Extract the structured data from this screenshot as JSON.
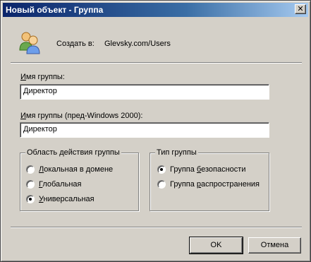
{
  "window": {
    "title": "Новый объект - Группа",
    "close_glyph": "✕"
  },
  "header": {
    "create_in_label": "Создать в:",
    "create_in_path": "Glevsky.com/Users",
    "icon": "users-group-icon"
  },
  "group_name": {
    "label_first": "И",
    "label_rest": "мя группы:",
    "value": "Директор"
  },
  "group_name_pre2000": {
    "label_first": "И",
    "label_rest": "мя группы (пред-Windows 2000):",
    "value": "Директор"
  },
  "scope": {
    "legend": "Область действия группы",
    "options": [
      {
        "pre": "",
        "u": "Л",
        "post": "окальная в домене",
        "checked": false
      },
      {
        "pre": "",
        "u": "Г",
        "post": "лобальная",
        "checked": false
      },
      {
        "pre": "",
        "u": "У",
        "post": "ниверсальная",
        "checked": true
      }
    ]
  },
  "type": {
    "legend": "Тип группы",
    "options": [
      {
        "pre": "Группа ",
        "u": "б",
        "post": "езопасности",
        "checked": true
      },
      {
        "pre": "Группа ",
        "u": "р",
        "post": "аспространения",
        "checked": false
      }
    ]
  },
  "buttons": {
    "ok": "OK",
    "cancel": "Отмена"
  },
  "colors": {
    "face": "#d4d0c8",
    "title_start": "#0a246a",
    "title_end": "#a6caf0"
  }
}
